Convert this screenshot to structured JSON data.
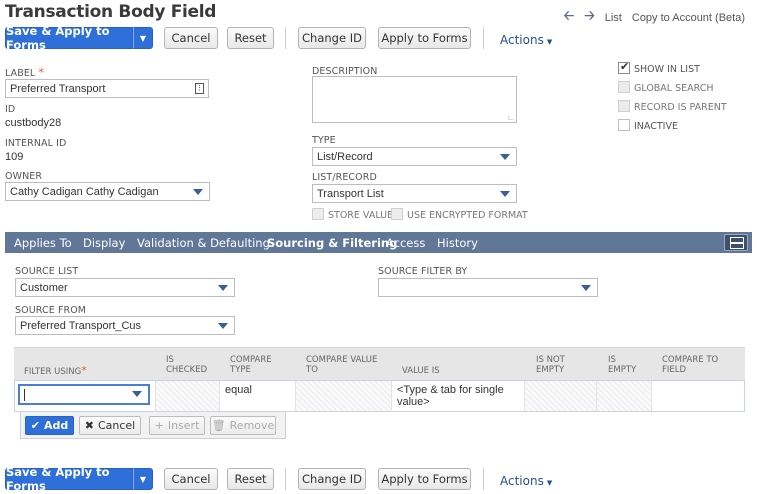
{
  "page": {
    "title": "Transaction Body Field",
    "nav": {
      "back_icon": "arrow-left-icon",
      "forward_icon": "arrow-right-icon",
      "list": "List",
      "copy": "Copy to Account (Beta)"
    }
  },
  "toolbar": {
    "save_apply": "Save & Apply to Forms",
    "cancel": "Cancel",
    "reset": "Reset",
    "change_id": "Change ID",
    "apply_forms": "Apply to Forms",
    "actions": "Actions"
  },
  "form": {
    "label_lbl": "LABEL",
    "label_req": "*",
    "label_val": "Preferred Transport",
    "id_lbl": "ID",
    "id_val": "custbody28",
    "internal_id_lbl": "INTERNAL ID",
    "internal_id_val": "109",
    "owner_lbl": "OWNER",
    "owner_val": "Cathy Cadigan Cathy Cadigan",
    "description_lbl": "DESCRIPTION",
    "type_lbl": "TYPE",
    "type_val": "List/Record",
    "list_record_lbl": "LIST/RECORD",
    "list_record_val": "Transport List",
    "store_value": "STORE VALUE",
    "use_encrypted": "USE ENCRYPTED FORMAT",
    "show_in_list": "SHOW IN LIST",
    "global_search": "GLOBAL SEARCH",
    "record_is_parent": "RECORD IS PARENT",
    "inactive": "INACTIVE"
  },
  "tabs": [
    {
      "label": "Applies To",
      "active": false
    },
    {
      "label": "Display",
      "active": false
    },
    {
      "label": "Validation & Defaulting",
      "active": false
    },
    {
      "label": "Sourcing & Filtering",
      "active": true
    },
    {
      "label": "Access",
      "active": false
    },
    {
      "label": "History",
      "active": false
    }
  ],
  "sourcing": {
    "source_list_lbl": "SOURCE LIST",
    "source_list_val": "Customer",
    "source_filter_by_lbl": "SOURCE FILTER BY",
    "source_filter_by_val": "",
    "source_from_lbl": "SOURCE FROM",
    "source_from_val": "Preferred Transport_Cus"
  },
  "filter_grid": {
    "headers": {
      "filter_using": "FILTER USING",
      "filter_req": "*",
      "is_checked_1": "IS",
      "is_checked_2": "CHECKED",
      "compare_type_1": "COMPARE",
      "compare_type_2": "TYPE",
      "compare_value_to_1": "COMPARE VALUE",
      "compare_value_to_2": "TO",
      "value_is": "VALUE IS",
      "is_not_empty_1": "IS NOT",
      "is_not_empty_2": "EMPTY",
      "is_empty_1": "IS",
      "is_empty_2": "EMPTY",
      "compare_to_field_1": "COMPARE TO",
      "compare_to_field_2": "FIELD"
    },
    "row": {
      "filter_using": "",
      "compare_type": "equal",
      "value_is_1": "<Type & tab for single",
      "value_is_2": "value>"
    },
    "buttons": {
      "add": "Add",
      "cancel": "Cancel",
      "insert": "Insert",
      "remove": "Remove"
    }
  }
}
